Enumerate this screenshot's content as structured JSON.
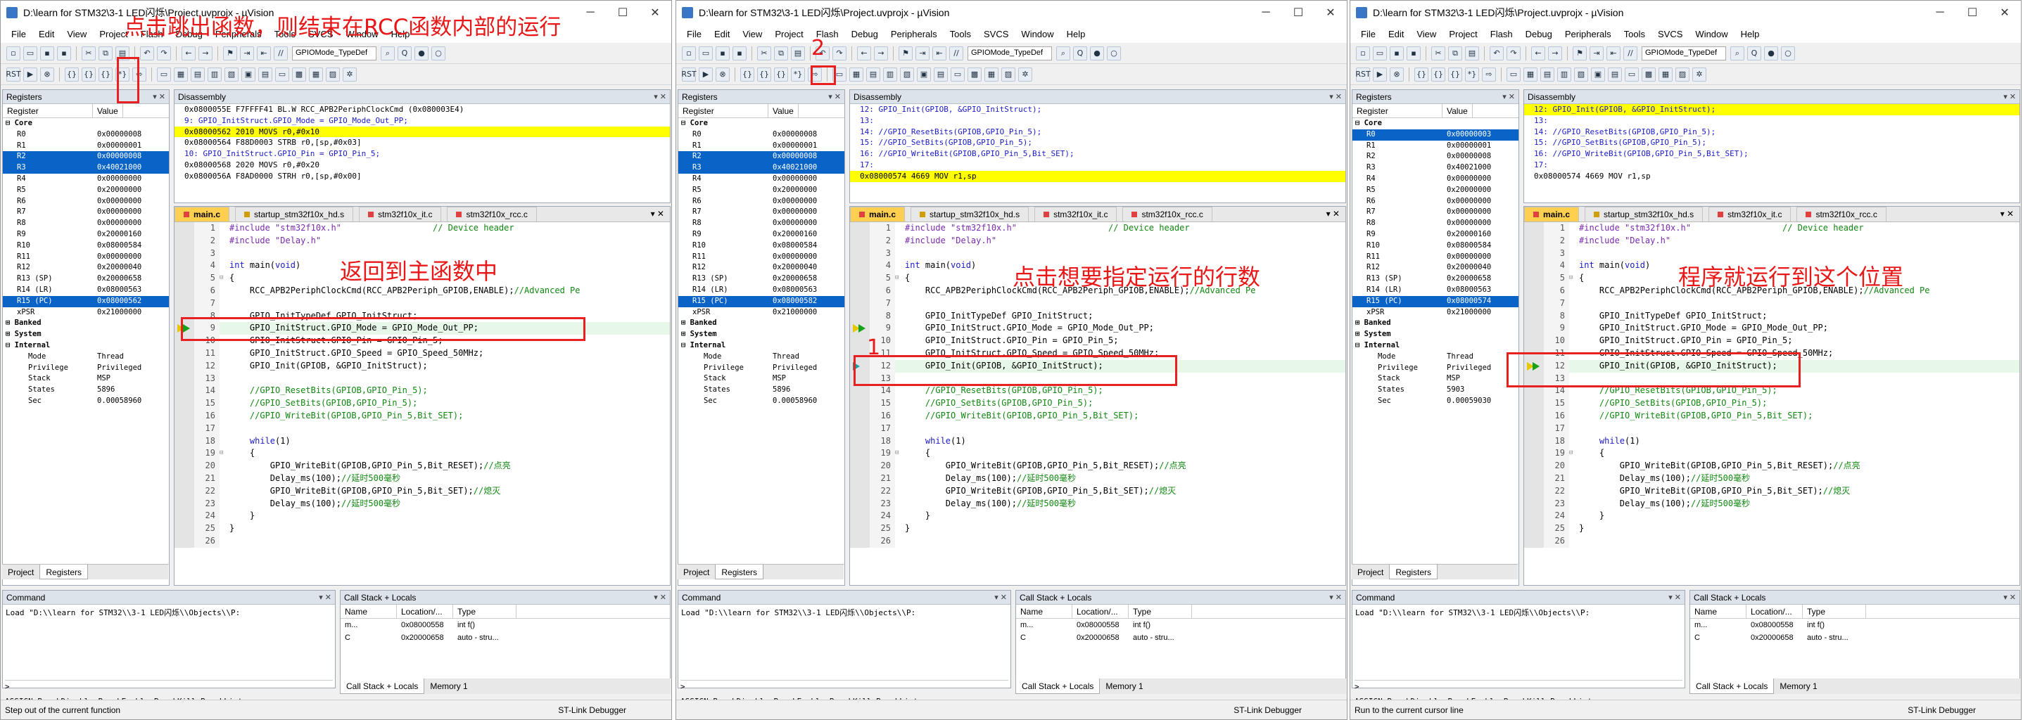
{
  "app": {
    "menu": [
      "File",
      "Edit",
      "View",
      "Project",
      "Flash",
      "Debug",
      "Peripherals",
      "Tools",
      "SVCS",
      "Window",
      "Help"
    ],
    "toolbar_combo": "GPIOMode_TypeDef",
    "panel_registers": "Registers",
    "panel_disassembly": "Disassembly",
    "panel_command": "Command",
    "panel_callstack": "Call Stack + Locals",
    "reg_col_register": "Register",
    "reg_col_value": "Value",
    "tab_project": "Project",
    "tab_registers": "Registers",
    "cs_col_name": "Name",
    "cs_col_location": "Location/...",
    "cs_col_type": "Type",
    "tab_callstack": "Call Stack + Locals",
    "tab_memory1": "Memory 1",
    "file_tabs": [
      "main.c",
      "startup_stm32f10x_hd.s",
      "stm32f10x_it.c",
      "stm32f10x_rcc.c"
    ],
    "cmd_load": "Load \"D:\\\\learn for STM32\\\\3-1 LED闪烁\\\\Objects\\\\P:",
    "cmd_prompt": ">",
    "cmd_keywords": "ASSIGN BreakDisable BreakEnable BreakKill BreakList",
    "debugger": "ST-Link Debugger",
    "callstack_rows": [
      {
        "name": "m...",
        "loc": "0x08000558",
        "type": "int f()"
      },
      {
        "name": "C",
        "loc": "0x20000658",
        "type": "auto - stru..."
      }
    ]
  },
  "code_lines": [
    {
      "n": "1",
      "pre": "#include \"stm32f10x.h\"",
      "cmt": "                  // Device header"
    },
    {
      "n": "2",
      "pre": "#include \"Delay.h\"",
      "cmt": ""
    },
    {
      "n": "3",
      "code": ""
    },
    {
      "n": "4",
      "code": "int main(void)"
    },
    {
      "n": "5",
      "code": "{"
    },
    {
      "n": "6",
      "code": "    RCC_APB2PeriphClockCmd(RCC_APB2Periph_GPIOB,ENABLE);",
      "cmt": "//Advanced Pe"
    },
    {
      "n": "7",
      "code": ""
    },
    {
      "n": "8",
      "code": "    GPIO_InitTypeDef GPIO_InitStruct;"
    },
    {
      "n": "9",
      "code": "    GPIO_InitStruct.GPIO_Mode = GPIO_Mode_Out_PP;"
    },
    {
      "n": "10",
      "code": "    GPIO_InitStruct.GPIO_Pin = GPIO_Pin_5;"
    },
    {
      "n": "11",
      "code": "    GPIO_InitStruct.GPIO_Speed = GPIO_Speed_50MHz;"
    },
    {
      "n": "12",
      "code": "    GPIO_Init(GPIOB, &GPIO_InitStruct);"
    },
    {
      "n": "13",
      "code": ""
    },
    {
      "n": "14",
      "code": "",
      "cmt": "    //GPIO_ResetBits(GPIOB,GPIO_Pin_5);"
    },
    {
      "n": "15",
      "code": "",
      "cmt": "    //GPIO_SetBits(GPIOB,GPIO_Pin_5);"
    },
    {
      "n": "16",
      "code": "",
      "cmt": "    //GPIO_WriteBit(GPIOB,GPIO_Pin_5,Bit_SET);"
    },
    {
      "n": "17",
      "code": ""
    },
    {
      "n": "18",
      "code": "    while(1)"
    },
    {
      "n": "19",
      "code": "    {"
    },
    {
      "n": "20",
      "code": "        GPIO_WriteBit(GPIOB,GPIO_Pin_5,Bit_RESET);",
      "cmt": "//点亮"
    },
    {
      "n": "21",
      "code": "        Delay_ms(100);",
      "cmt": "//延时500毫秒"
    },
    {
      "n": "22",
      "code": "        GPIO_WriteBit(GPIOB,GPIO_Pin_5,Bit_SET);",
      "cmt": "//熄灭"
    },
    {
      "n": "23",
      "code": "        Delay_ms(100);",
      "cmt": "//延时500毫秒"
    },
    {
      "n": "24",
      "code": "    }"
    },
    {
      "n": "25",
      "code": "}"
    },
    {
      "n": "26",
      "code": ""
    }
  ],
  "windows": [
    {
      "title": "D:\\learn for STM32\\3-1 LED闪烁\\Project.uvprojx - µVision",
      "status": "Step out of the current function",
      "regs": [
        [
          "R0",
          "0x00000008"
        ],
        [
          "R1",
          "0x00000001"
        ],
        [
          "R2",
          "0x00000008"
        ],
        [
          "R3",
          "0x40021000"
        ],
        [
          "R4",
          "0x00000000"
        ],
        [
          "R5",
          "0x20000000"
        ],
        [
          "R6",
          "0x00000000"
        ],
        [
          "R7",
          "0x00000000"
        ],
        [
          "R8",
          "0x00000000"
        ],
        [
          "R9",
          "0x20000160"
        ],
        [
          "R10",
          "0x08000584"
        ],
        [
          "R11",
          "0x00000000"
        ],
        [
          "R12",
          "0x20000040"
        ],
        [
          "R13 (SP)",
          "0x20000658"
        ],
        [
          "R14 (LR)",
          "0x08000563"
        ],
        [
          "R15 (PC)",
          "0x08000562"
        ],
        [
          "xPSR",
          "0x21000000"
        ]
      ],
      "internal": [
        [
          "Mode",
          "Thread"
        ],
        [
          "Privilege",
          "Privileged"
        ],
        [
          "Stack",
          "MSP"
        ],
        [
          "States",
          "5896"
        ],
        [
          "Sec",
          "0.00058960"
        ]
      ],
      "disasm": [
        "0x0800055E F7FFFF41  BL.W     RCC_APB2PeriphClockCmd (0x080003E4)",
        "     9:        GPIO_InitStruct.GPIO_Mode = GPIO_Mode_Out_PP;",
        "0x08000562 2010      MOVS     r0,#0x10",
        "0x08000564 F88D0003  STRB     r0,[sp,#0x03]",
        "    10:        GPIO_InitStruct.GPIO_Pin = GPIO_Pin_5;",
        "0x08000568 2020      MOVS     r0,#0x20",
        "0x0800056A F8AD0000  STRH     r0,[sp,#0x00]"
      ],
      "annotation1": "点击跳出函数，则结束在RCC函数内部的运行",
      "annotation2": "返回到主函数中"
    },
    {
      "title": "D:\\learn for STM32\\3-1 LED闪烁\\Project.uvprojx - µVision",
      "status": "",
      "regs": [
        [
          "R0",
          "0x00000008"
        ],
        [
          "R1",
          "0x00000001"
        ],
        [
          "R2",
          "0x00000008"
        ],
        [
          "R3",
          "0x40021000"
        ],
        [
          "R4",
          "0x00000000"
        ],
        [
          "R5",
          "0x20000000"
        ],
        [
          "R6",
          "0x00000000"
        ],
        [
          "R7",
          "0x00000000"
        ],
        [
          "R8",
          "0x00000000"
        ],
        [
          "R9",
          "0x20000160"
        ],
        [
          "R10",
          "0x08000584"
        ],
        [
          "R11",
          "0x00000000"
        ],
        [
          "R12",
          "0x20000040"
        ],
        [
          "R13 (SP)",
          "0x20000658"
        ],
        [
          "R14 (LR)",
          "0x08000563"
        ],
        [
          "R15 (PC)",
          "0x08000582"
        ],
        [
          "xPSR",
          "0x21000000"
        ]
      ],
      "internal": [
        [
          "Mode",
          "Thread"
        ],
        [
          "Privilege",
          "Privileged"
        ],
        [
          "Stack",
          "MSP"
        ],
        [
          "States",
          "5896"
        ],
        [
          "Sec",
          "0.00058960"
        ]
      ],
      "disasm": [
        "    12:        GPIO_Init(GPIOB, &GPIO_InitStruct);",
        "    13:",
        "    14:        //GPIO_ResetBits(GPIOB,GPIO_Pin_5);",
        "    15:        //GPIO_SetBits(GPIOB,GPIO_Pin_5);",
        "    16:        //GPIO_WriteBit(GPIOB,GPIO_Pin_5,Bit_SET);",
        "    17:",
        "0x08000574 4669      MOV      r1,sp"
      ],
      "annotation1": "2",
      "annotation2": "点击想要指定运行的行数",
      "annotation3": "1"
    },
    {
      "title": "D:\\learn for STM32\\3-1 LED闪烁\\Project.uvprojx - µVision",
      "status": "Run to the current cursor line",
      "regs": [
        [
          "R0",
          "0x00000003"
        ],
        [
          "R1",
          "0x00000001"
        ],
        [
          "R2",
          "0x00000008"
        ],
        [
          "R3",
          "0x40021000"
        ],
        [
          "R4",
          "0x00000000"
        ],
        [
          "R5",
          "0x20000000"
        ],
        [
          "R6",
          "0x00000000"
        ],
        [
          "R7",
          "0x00000000"
        ],
        [
          "R8",
          "0x00000000"
        ],
        [
          "R9",
          "0x20000160"
        ],
        [
          "R10",
          "0x08000584"
        ],
        [
          "R11",
          "0x00000000"
        ],
        [
          "R12",
          "0x20000040"
        ],
        [
          "R13 (SP)",
          "0x20000658"
        ],
        [
          "R14 (LR)",
          "0x08000563"
        ],
        [
          "R15 (PC)",
          "0x08000574"
        ],
        [
          "xPSR",
          "0x21000000"
        ]
      ],
      "internal": [
        [
          "Mode",
          "Thread"
        ],
        [
          "Privilege",
          "Privileged"
        ],
        [
          "Stack",
          "MSP"
        ],
        [
          "States",
          "5903"
        ],
        [
          "Sec",
          "0.00059030"
        ]
      ],
      "disasm": [
        "    12:        GPIO_Init(GPIOB, &GPIO_InitStruct);",
        "    13:",
        "    14:        //GPIO_ResetBits(GPIOB,GPIO_Pin_5);",
        "    15:        //GPIO_SetBits(GPIOB,GPIO_Pin_5);",
        "    16:        //GPIO_WriteBit(GPIOB,GPIO_Pin_5,Bit_SET);",
        "    17:",
        "0x08000574 4669      MOV      r1,sp"
      ],
      "annotation2": "程序就运行到这个位置"
    }
  ],
  "tree_labels": {
    "core": "Core",
    "banked": "Banked",
    "system": "System",
    "internal": "Internal"
  },
  "colors": {
    "annotation": "#e81818",
    "selection": "#0a64c8",
    "pc_highlight": "#ffff00"
  }
}
